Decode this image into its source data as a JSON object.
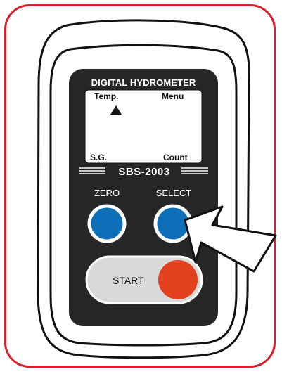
{
  "device": {
    "title": "DIGITAL HYDROMETER",
    "model": "SBS-2003",
    "lcd": {
      "top_left": "Temp.",
      "top_right": "Menu",
      "bottom_left": "S.G.",
      "bottom_right": "Count"
    },
    "buttons": {
      "zero_label": "ZERO",
      "select_label": "SELECT",
      "start_label": "START"
    }
  },
  "colors": {
    "frame": "#d6202c",
    "panel": "#262626",
    "blue_button": "#0d6fb8",
    "red_button": "#e2401f",
    "lcd": "#ffffff"
  },
  "icons": {
    "indicator": "triangle-up-icon",
    "pointer": "arrow-pointer-icon"
  }
}
